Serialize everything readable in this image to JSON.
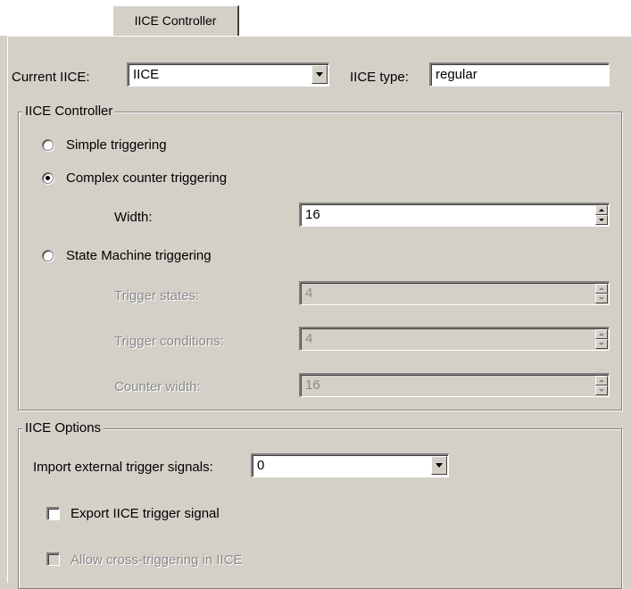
{
  "tabs": [
    {
      "label": "IICE Controller"
    }
  ],
  "current_iice": {
    "label": "Current IICE:",
    "value": "IICE"
  },
  "iice_type": {
    "label": "IICE type:",
    "value": "regular"
  },
  "controller_group": {
    "legend": "IICE Controller",
    "simple": {
      "label": "Simple triggering",
      "checked": false
    },
    "complex": {
      "label": "Complex counter triggering",
      "checked": true
    },
    "width": {
      "label": "Width:",
      "value": "16"
    },
    "state_machine": {
      "label": "State Machine triggering",
      "checked": false
    },
    "trigger_states": {
      "label": "Trigger states:",
      "value": "4"
    },
    "trigger_conditions": {
      "label": "Trigger conditions:",
      "value": "4"
    },
    "counter_width": {
      "label": "Counter width:",
      "value": "16"
    }
  },
  "options_group": {
    "legend": "IICE Options",
    "import_external": {
      "label": "Import external trigger signals:",
      "value": "0"
    },
    "export_trigger": {
      "label": "Export IICE trigger signal",
      "checked": false
    },
    "cross_triggering": {
      "label": "Allow cross-triggering in IICE",
      "checked": false
    }
  }
}
